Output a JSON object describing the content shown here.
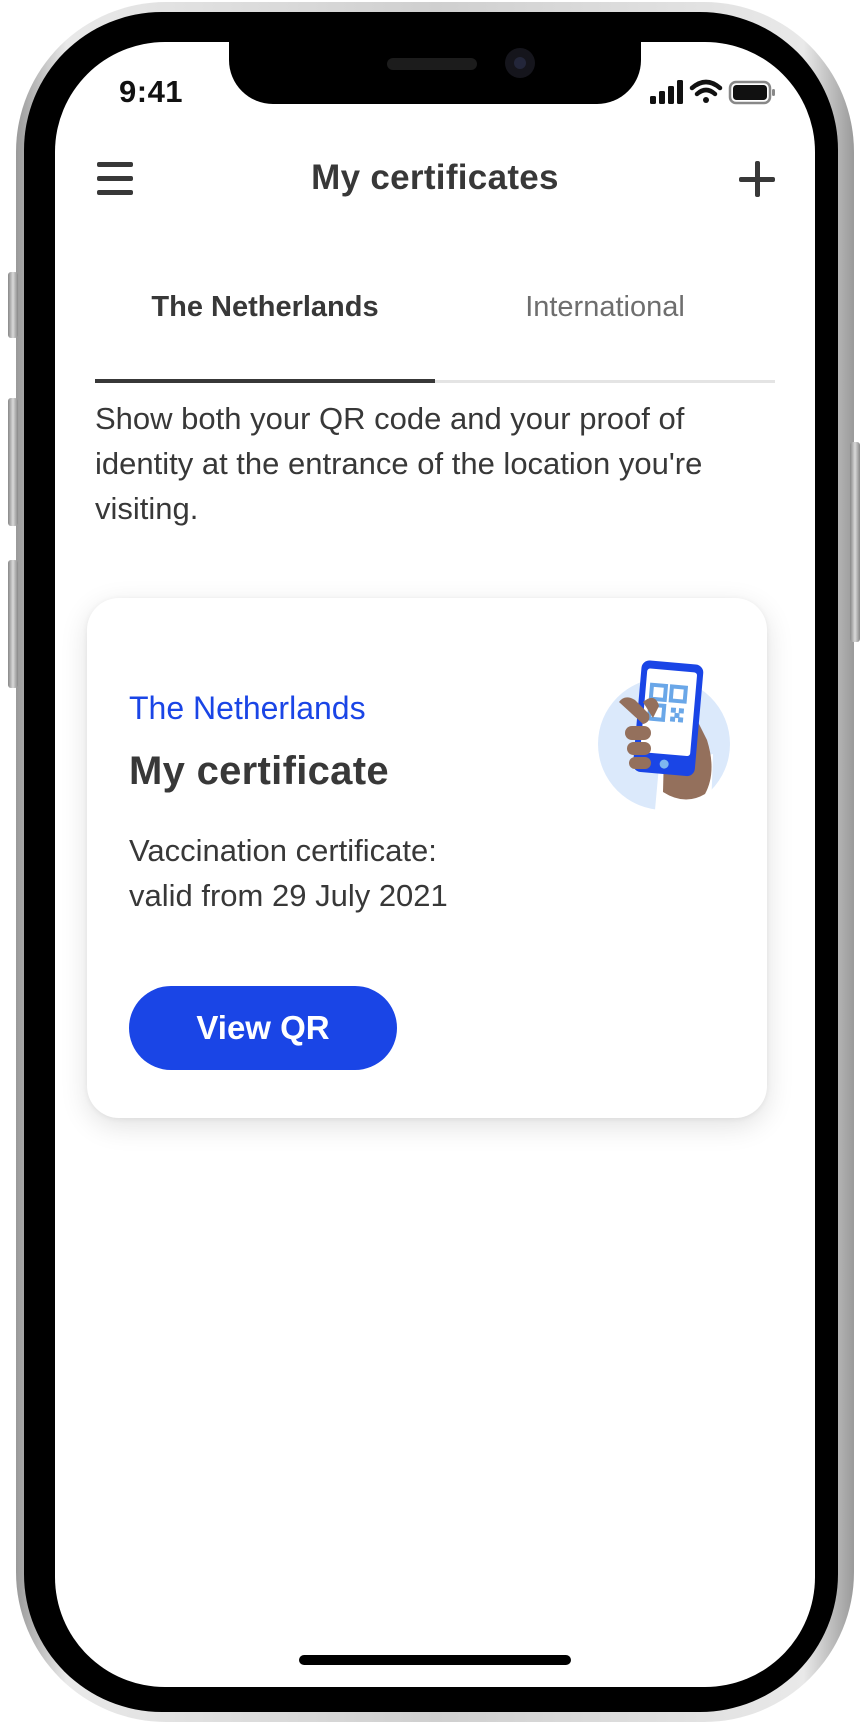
{
  "status_bar": {
    "time": "9:41"
  },
  "header": {
    "title": "My certificates",
    "menu_icon": "hamburger-menu-icon",
    "add_icon": "plus-icon"
  },
  "tabs": [
    {
      "label": "The Netherlands",
      "selected": true
    },
    {
      "label": "International",
      "selected": false
    }
  ],
  "intro_text": "Show both your QR code and your proof of identity at the entrance of the location you're visiting.",
  "card": {
    "country": "The Netherlands",
    "title": "My certificate",
    "detail_lines": [
      "Vaccination certificate:",
      "valid from 29 July 2021"
    ],
    "button_label": "View QR",
    "illustration_icon": "hand-holding-phone-qr-icon"
  },
  "colors": {
    "accent_blue": "#1a45e6",
    "text_dark": "#383838",
    "text_muted": "#6e6e6e",
    "illustration_circle": "#dbe9fb"
  }
}
